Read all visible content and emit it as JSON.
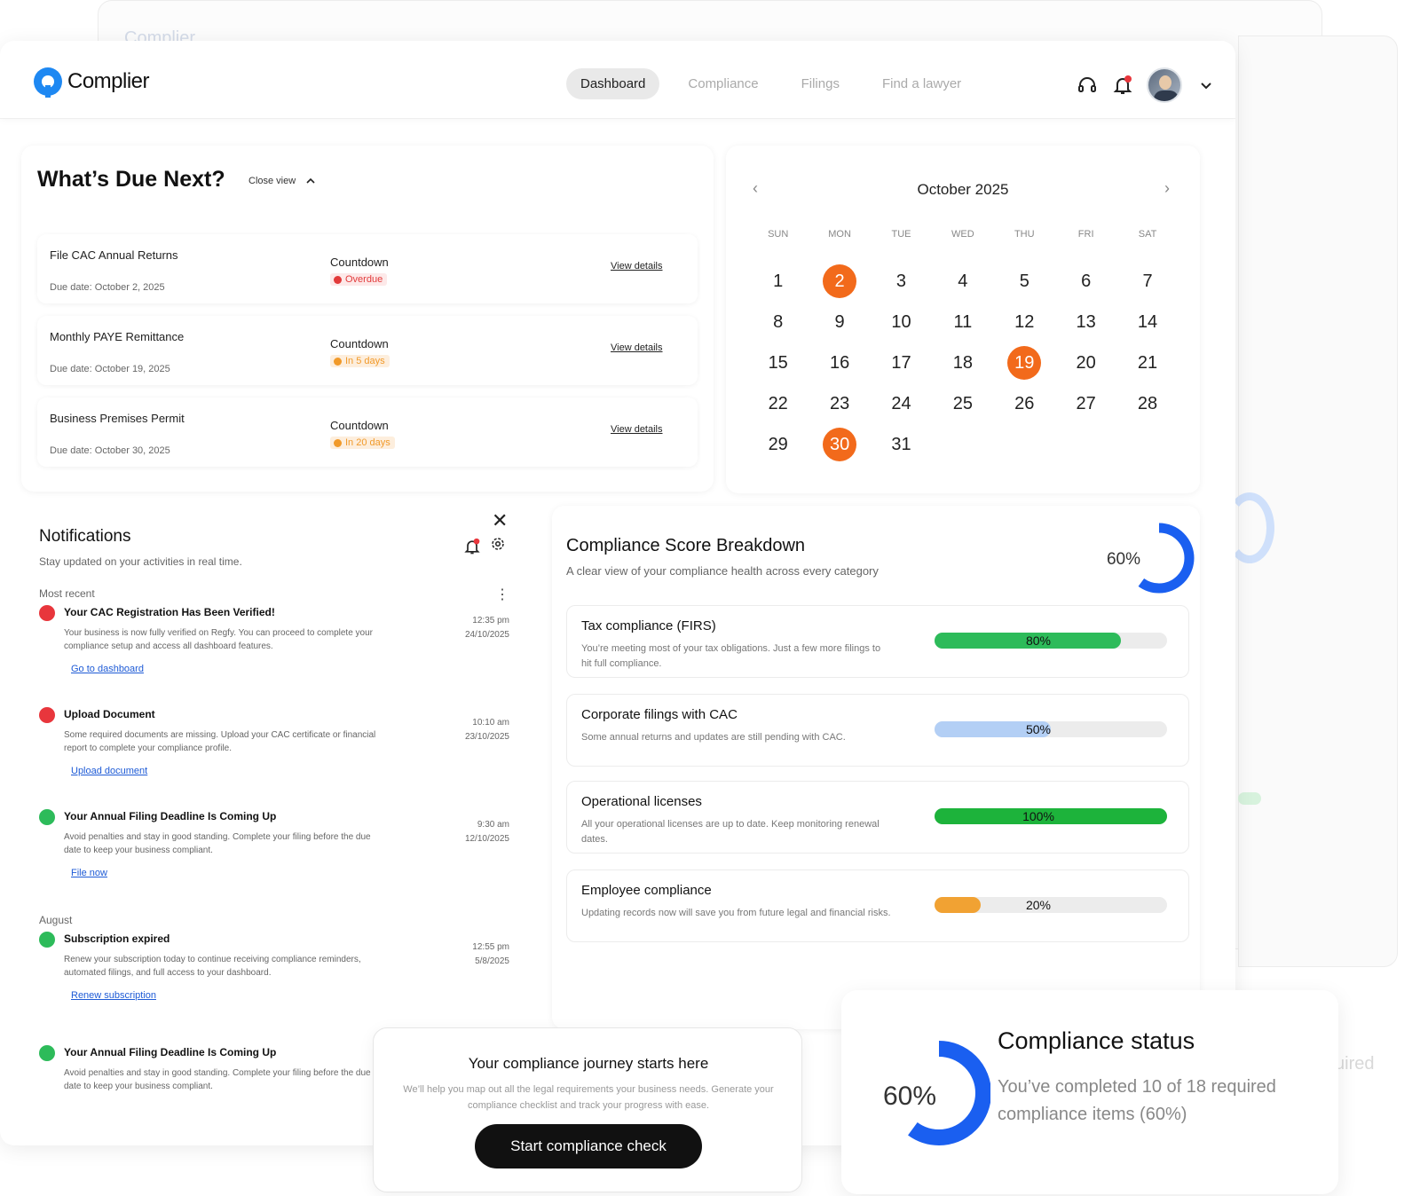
{
  "app": {
    "name": "Complier",
    "brand_color": "#1e88f2",
    "accent_color": "#f26a1b"
  },
  "nav": [
    {
      "label": "Dashboard",
      "active": true
    },
    {
      "label": "Compliance",
      "active": false
    },
    {
      "label": "Filings",
      "active": false
    },
    {
      "label": "Find a lawyer",
      "active": false
    }
  ],
  "due": {
    "title": "What’s Due Next?",
    "close_view": "Close view",
    "items": [
      {
        "name": "File CAC Annual Returns",
        "date": "Due date: October 2, 2025",
        "countdown": "Countdown",
        "status": "Overdue",
        "status_color": "red",
        "link": "View details"
      },
      {
        "name": "Monthly PAYE Remittance",
        "date": "Due date: October 19, 2025",
        "countdown": "Countdown",
        "status": "In 5 days",
        "status_color": "orange",
        "link": "View details"
      },
      {
        "name": "Business Premises Permit",
        "date": "Due date: October 30, 2025",
        "countdown": "Countdown",
        "status": "In 20 days",
        "status_color": "orange",
        "link": "View details"
      }
    ]
  },
  "calendar": {
    "month": "October 2025",
    "weekdays": [
      "SUN",
      "MON",
      "TUE",
      "WED",
      "THU",
      "FRI",
      "SAT"
    ],
    "start_offset": 0,
    "days_in_month": 31,
    "highlighted": [
      2,
      19,
      30
    ]
  },
  "notifications": {
    "title": "Notifications",
    "subtitle": "Stay updated on your activities in real time.",
    "section_recent": "Most recent",
    "section_august": "August",
    "items": [
      {
        "color": "red",
        "title": "Your CAC Registration Has Been Verified!",
        "body": "Your business is now fully verified on Regfy. You can proceed to complete your compliance setup and access all dashboard features.",
        "link": "Go to dashboard",
        "time": "12:35 pm",
        "date": "24/10/2025"
      },
      {
        "color": "red",
        "title": "Upload Document",
        "body": "Some required documents are missing. Upload your CAC certificate or financial report to complete your compliance profile.",
        "link": "Upload document",
        "time": "10:10 am",
        "date": "23/10/2025"
      },
      {
        "color": "green",
        "title": "Your Annual Filing Deadline Is Coming Up",
        "body": "Avoid penalties and stay in good standing. Complete your filing before the due date to keep your business compliant.",
        "link": "File now",
        "time": "9:30 am",
        "date": "12/10/2025"
      },
      {
        "color": "green",
        "title": "Subscription expired",
        "body": "Renew your subscription today to continue receiving compliance reminders, automated filings, and full access to your dashboard.",
        "link": "Renew subscription",
        "time": "12:55 pm",
        "date": "5/8/2025"
      },
      {
        "color": "green",
        "title": "Your Annual Filing Deadline Is Coming Up",
        "body": "Avoid penalties and stay in good standing. Complete your filing before the due date to keep your business compliant.",
        "link": "",
        "time": "",
        "date": ""
      }
    ]
  },
  "score": {
    "title": "Compliance Score Breakdown",
    "subtitle": "A clear view of your compliance health across every category",
    "percent": 60,
    "percent_label": "60%",
    "items": [
      {
        "title": "Tax compliance (FIRS)",
        "desc": "You’re meeting most of your tax obligations. Just a few more filings to hit full compliance.",
        "value": 80,
        "label": "80%",
        "color": "#2dbb5a"
      },
      {
        "title": "Corporate filings with CAC",
        "desc": "Some annual returns and updates are still pending with CAC.",
        "value": 50,
        "label": "50%",
        "color": "#b3cff5"
      },
      {
        "title": "Operational licenses",
        "desc": "All your operational licenses are up to date. Keep monitoring renewal dates.",
        "value": 100,
        "label": "100%",
        "color": "#1db33b"
      },
      {
        "title": "Employee compliance",
        "desc": "Updating records now will save you from future legal and financial risks.",
        "value": 20,
        "label": "20%",
        "color": "#f1a233"
      }
    ]
  },
  "journey": {
    "title": "Your compliance journey starts here",
    "body": "We’ll help you map out all the legal requirements your business needs. Generate your compliance checklist and track your progress with ease.",
    "button": "Start compliance check"
  },
  "status": {
    "title": "Compliance status",
    "percent": 60,
    "percent_label": "60%",
    "body": "You’ve completed 10 of 18 required compliance items (60%)"
  },
  "ghost": {
    "logo": "Complier",
    "text": "uired"
  }
}
